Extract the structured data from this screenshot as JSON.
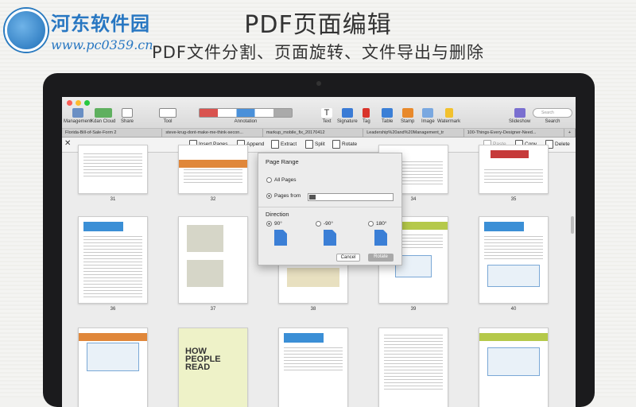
{
  "watermark": {
    "name": "河东软件园",
    "url": "www.pc0359.cn"
  },
  "headline": "PDF页面编辑",
  "subline": "PDF文件分割、页面旋转、文件导出与删除",
  "toolbar": [
    {
      "label": "Management",
      "icon": "sidebar-icon"
    },
    {
      "label": "Kdan Cloud",
      "icon": "cloud-icon"
    },
    {
      "label": "Share",
      "icon": "share-icon"
    },
    {
      "label": "Tool",
      "icon": "hand-icon"
    },
    {
      "label": "Annotation",
      "icon": "annotation-icon"
    },
    {
      "label": "Text",
      "icon": "text-icon"
    },
    {
      "label": "Signature",
      "icon": "pen-icon"
    },
    {
      "label": "Tag",
      "icon": "tag-icon"
    },
    {
      "label": "Table",
      "icon": "table-icon"
    },
    {
      "label": "Stamp",
      "icon": "stamp-icon"
    },
    {
      "label": "Image",
      "icon": "image-icon"
    },
    {
      "label": "Watermark",
      "icon": "watermark-icon"
    },
    {
      "label": "Slideshow",
      "icon": "slideshow-icon"
    },
    {
      "label": "Search",
      "icon": "search-icon"
    }
  ],
  "search_placeholder": "Search",
  "tabs": [
    "Florida-Bill-of-Sale-Form 2",
    "steve-krug-dont-make-me-think-secon...",
    "markup_mobile_fix_20170412",
    "Leadership%20and%20Management_tr",
    "100-Things-Every-Designer-Need..."
  ],
  "pagebar": {
    "insert": "Insert Pages",
    "append": "Append",
    "extract": "Extract",
    "split": "Split",
    "rotate": "Rotate",
    "paste": "Paste",
    "copy": "Copy",
    "delete": "Delete"
  },
  "dialog": {
    "page_range": "Page Range",
    "all_pages": "All Pages",
    "pages_from": "Pages from",
    "direction": "Direction",
    "deg90": "90°",
    "degm90": "-90°",
    "deg180": "180°",
    "cancel": "Cancel",
    "rotate": "Rotate"
  },
  "page_numbers": [
    "31",
    "32",
    "34",
    "35",
    "36",
    "37",
    "38",
    "39",
    "40"
  ],
  "thumb_titles": {
    "p37_tag": "HOW PEOPLE READ"
  }
}
